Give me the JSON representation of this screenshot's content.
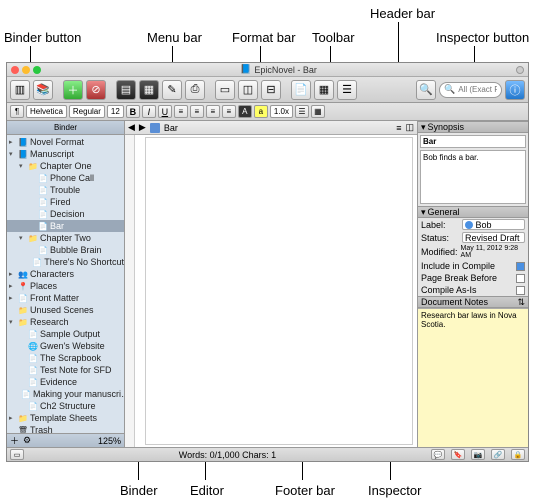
{
  "callouts": {
    "binder_button": "Binder button",
    "menu_bar": "Menu bar",
    "format_bar": "Format bar",
    "toolbar": "Toolbar",
    "header_bar": "Header bar",
    "inspector_button": "Inspector button",
    "binder": "Binder",
    "editor": "Editor",
    "footer_bar": "Footer bar",
    "inspector": "Inspector"
  },
  "window_title": "EpicNovel - Bar",
  "search_placeholder": "All (Exact Phrase)",
  "format": {
    "font": "Helvetica",
    "style": "Regular",
    "size": "12",
    "spacing": "1.0x"
  },
  "binder_label": "Binder",
  "tree": [
    {
      "d": 0,
      "t": "▸",
      "i": "📘",
      "l": "Novel Format"
    },
    {
      "d": 0,
      "t": "▾",
      "i": "📘",
      "l": "Manuscript"
    },
    {
      "d": 1,
      "t": "▾",
      "i": "📁",
      "l": "Chapter One"
    },
    {
      "d": 2,
      "t": "",
      "i": "📄",
      "l": "Phone Call"
    },
    {
      "d": 2,
      "t": "",
      "i": "📄",
      "l": "Trouble"
    },
    {
      "d": 2,
      "t": "",
      "i": "📄",
      "l": "Fired"
    },
    {
      "d": 2,
      "t": "",
      "i": "📄",
      "l": "Decision"
    },
    {
      "d": 2,
      "t": "",
      "i": "📄",
      "l": "Bar",
      "sel": true
    },
    {
      "d": 1,
      "t": "▾",
      "i": "📁",
      "l": "Chapter Two"
    },
    {
      "d": 2,
      "t": "",
      "i": "📄",
      "l": "Bubble Brain"
    },
    {
      "d": 2,
      "t": "",
      "i": "📄",
      "l": "There's No Shortcut"
    },
    {
      "d": 0,
      "t": "▸",
      "i": "👥",
      "l": "Characters"
    },
    {
      "d": 0,
      "t": "▸",
      "i": "📍",
      "l": "Places"
    },
    {
      "d": 0,
      "t": "▸",
      "i": "📄",
      "l": "Front Matter"
    },
    {
      "d": 0,
      "t": "",
      "i": "📁",
      "l": "Unused Scenes"
    },
    {
      "d": 0,
      "t": "▾",
      "i": "📁",
      "l": "Research"
    },
    {
      "d": 1,
      "t": "",
      "i": "📄",
      "l": "Sample Output"
    },
    {
      "d": 1,
      "t": "",
      "i": "🌐",
      "l": "Gwen's Website"
    },
    {
      "d": 1,
      "t": "",
      "i": "📄",
      "l": "The Scrapbook"
    },
    {
      "d": 1,
      "t": "",
      "i": "📄",
      "l": "Test Note for SFD"
    },
    {
      "d": 1,
      "t": "",
      "i": "📄",
      "l": "Evidence"
    },
    {
      "d": 1,
      "t": "",
      "i": "📄",
      "l": "Making your manuscri…"
    },
    {
      "d": 1,
      "t": "",
      "i": "📄",
      "l": "Ch2 Structure"
    },
    {
      "d": 0,
      "t": "▸",
      "i": "📁",
      "l": "Template Sheets"
    },
    {
      "d": 0,
      "t": "",
      "i": "🗑",
      "l": "Trash"
    }
  ],
  "binder_foot_zoom": "125%",
  "header_doc": "Bar",
  "footer": "Words: 0/1,000   Chars: 1",
  "inspector": {
    "synopsis_head": "Synopsis",
    "syn_title": "Bar",
    "syn_body": "Bob finds a bar.",
    "general_head": "General",
    "label_lbl": "Label:",
    "label_val": "Bob",
    "status_lbl": "Status:",
    "status_val": "Revised Draft",
    "modified_lbl": "Modified:",
    "modified_val": "May 11, 2012 9:28 AM",
    "include_lbl": "Include in Compile",
    "pagebreak_lbl": "Page Break Before",
    "asis_lbl": "Compile As-Is",
    "notes_head": "Document Notes",
    "notes_body": "Research bar laws in Nova Scotia."
  }
}
